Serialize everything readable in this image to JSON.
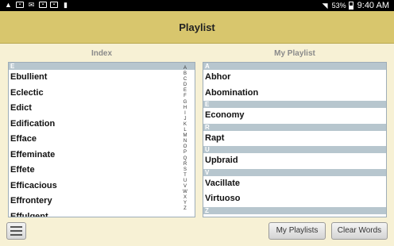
{
  "status_bar": {
    "left_icons": [
      "warning-icon",
      "image-icon",
      "email-icon",
      "calendar-icon",
      "photo-icon",
      "trash-icon"
    ],
    "battery": "53%",
    "time": "9:40 AM"
  },
  "app_bar": {
    "title": "Playlist"
  },
  "index": {
    "title": "Index",
    "section": "E",
    "words": [
      "Ebullient",
      "Eclectic",
      "Edict",
      "Edification",
      "Efface",
      "Effeminate",
      "Effete",
      "Efficacious",
      "Effrontery",
      "Effulgent"
    ],
    "alphabet": [
      "A",
      "B",
      "C",
      "D",
      "E",
      "F",
      "G",
      "H",
      "I",
      "J",
      "K",
      "L",
      "M",
      "N",
      "O",
      "P",
      "Q",
      "R",
      "S",
      "T",
      "U",
      "V",
      "W",
      "X",
      "Y",
      "Z"
    ]
  },
  "playlist": {
    "title": "My Playlist",
    "sections": [
      {
        "header": "A",
        "words": [
          "Abhor",
          "Abomination"
        ]
      },
      {
        "header": "E",
        "words": [
          "Economy"
        ]
      },
      {
        "header": "R",
        "words": [
          "Rapt"
        ]
      },
      {
        "header": "U",
        "words": [
          "Upbraid"
        ]
      },
      {
        "header": "V",
        "words": [
          "Vacillate",
          "Virtuoso"
        ]
      },
      {
        "header": "Z",
        "words": []
      }
    ]
  },
  "buttons": {
    "my_playlists": "My Playlists",
    "clear_words": "Clear Words"
  },
  "colors": {
    "app_bar": "#d8c66d",
    "background": "#f7f1d5",
    "section_header": "#b7c6ce"
  }
}
